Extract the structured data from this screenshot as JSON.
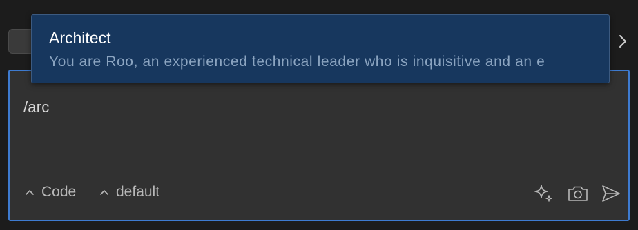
{
  "input": {
    "value": "/arc"
  },
  "toolbar": {
    "mode_label": "Code",
    "profile_label": "default"
  },
  "dropdown": {
    "item_title": "Architect",
    "item_description": "You are Roo, an experienced technical leader who is inquisitive and an e"
  },
  "icons": {
    "mode_caret": "caret-up-icon",
    "profile_caret": "caret-up-icon",
    "enhance": "sparkle-icon",
    "camera": "camera-icon",
    "send": "send-icon",
    "nav": "chevron-right-icon"
  },
  "colors": {
    "input_border": "#3e7bd0",
    "dropdown_bg": "#17375e",
    "input_bg": "#313131",
    "page_bg": "#1c1c1c"
  }
}
